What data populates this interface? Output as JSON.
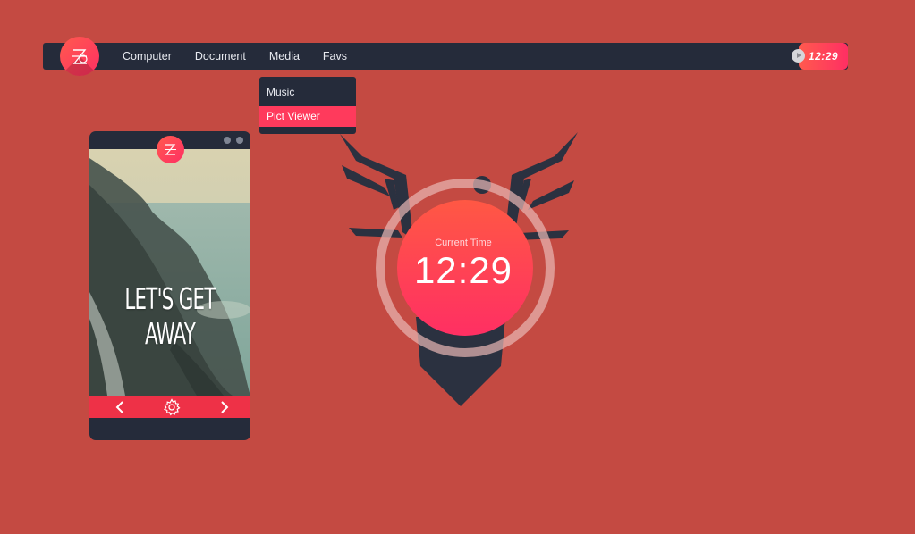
{
  "topbar": {
    "menu": [
      "Computer",
      "Document",
      "Media",
      "Favs"
    ],
    "time": "12:29"
  },
  "dropdown": {
    "items": [
      "Music",
      "Pict Viewer"
    ],
    "selected": "Pict Viewer"
  },
  "phone": {
    "slogan": "LET'S GET AWAY",
    "controls": [
      "chevron-left-icon",
      "gear-icon",
      "chevron-right-icon"
    ]
  },
  "clock": {
    "label": "Current Time",
    "time": "12:29"
  },
  "colors": {
    "background": "#c44a42",
    "panel": "#252b3a",
    "accent": "#ff3a5c",
    "accent_gradient_start": "#ff5a4e"
  }
}
